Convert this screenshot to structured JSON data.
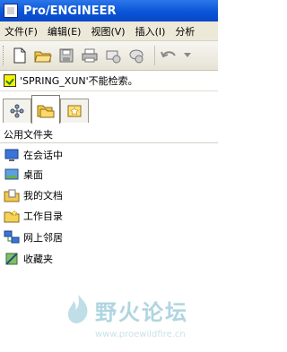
{
  "window": {
    "title": "Pro/ENGINEER"
  },
  "menubar": {
    "items": [
      {
        "label": "文件(F)"
      },
      {
        "label": "编辑(E)"
      },
      {
        "label": "视图(V)"
      },
      {
        "label": "插入(I)"
      },
      {
        "label": "分析"
      }
    ]
  },
  "toolbar": {
    "buttons": [
      "new-file-icon",
      "open-folder-icon",
      "save-icon",
      "print-icon",
      "mail-icon",
      "mail-send-icon",
      "undo-icon"
    ]
  },
  "message": {
    "text": "'SPRING_XUN'不能检索。"
  },
  "tabs": [
    {
      "icon": "model-tree-icon"
    },
    {
      "icon": "folder-browser-icon"
    },
    {
      "icon": "favorites-icon"
    }
  ],
  "panel": {
    "header": "公用文件夹",
    "items": [
      {
        "label": "在会话中",
        "icon": "in-session-icon"
      },
      {
        "label": "桌面",
        "icon": "desktop-icon"
      },
      {
        "label": "我的文档",
        "icon": "my-documents-icon"
      },
      {
        "label": "工作目录",
        "icon": "working-directory-icon"
      },
      {
        "label": "网上邻居",
        "icon": "network-icon"
      },
      {
        "label": "收藏夹",
        "icon": "favorites-folder-icon"
      }
    ]
  },
  "watermark": {
    "text": "野火论坛",
    "url": "www.proewildfire.cn"
  },
  "colors": {
    "titlebar": "#0b55d8",
    "menubar": "#ece9d8",
    "watermark": "#6fb3c9"
  }
}
